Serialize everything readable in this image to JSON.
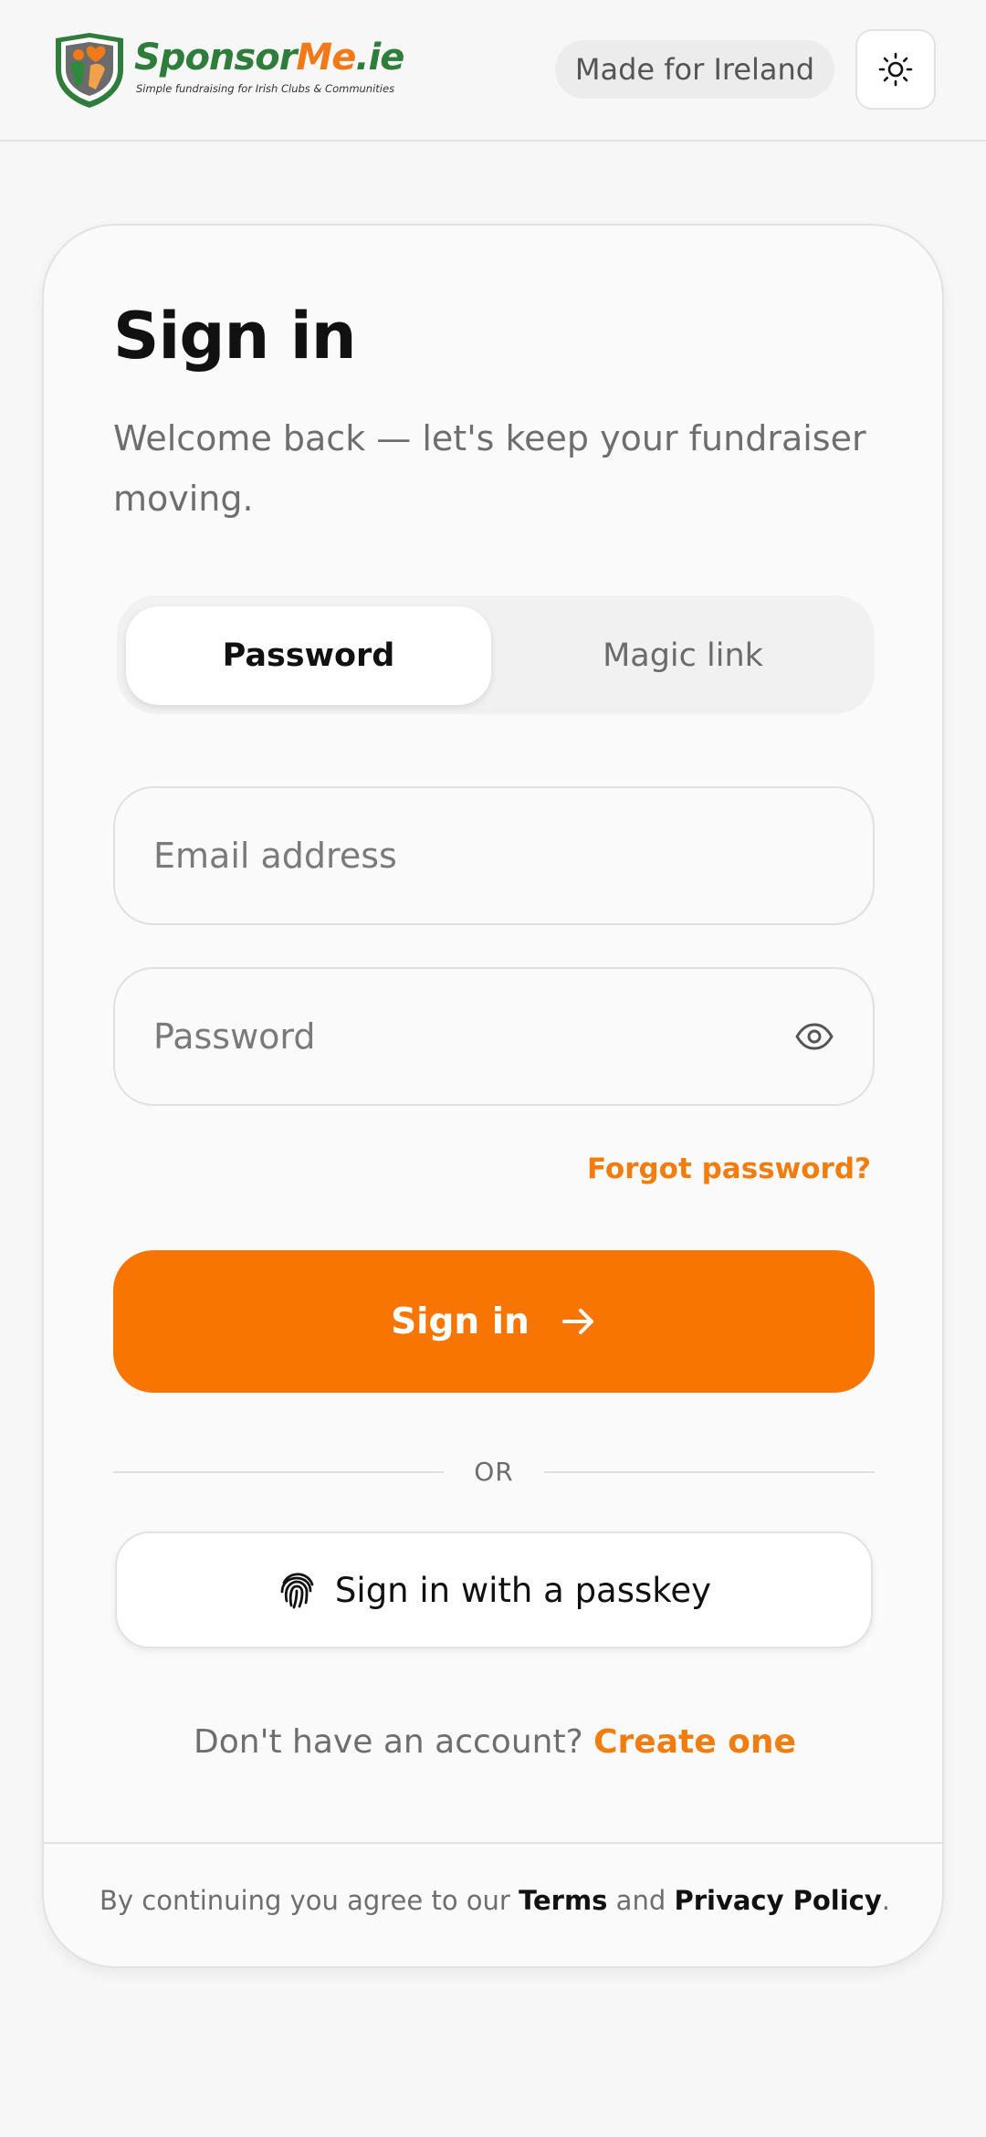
{
  "header": {
    "logo": {
      "name_part1": "Sponsor",
      "name_part2": "Me",
      "name_part3": ".ie",
      "tagline": "Simple fundraising for Irish Clubs & Communities"
    },
    "badge": "Made for Ireland",
    "theme_toggle_icon": "sun-icon"
  },
  "card": {
    "title": "Sign in",
    "subtitle": "Welcome back — let's keep your fundraiser moving.",
    "tabs": [
      {
        "label": "Password",
        "active": true
      },
      {
        "label": "Magic link",
        "active": false
      }
    ],
    "email": {
      "placeholder": "Email address",
      "value": ""
    },
    "password": {
      "placeholder": "Password",
      "value": "",
      "toggle_icon": "eye-icon"
    },
    "forgot_label": "Forgot password?",
    "submit_label": "Sign in",
    "submit_icon": "arrow-right-icon",
    "divider_label": "OR",
    "passkey_label": "Sign in with a passkey",
    "passkey_icon": "fingerprint-icon",
    "signup": {
      "prompt": "Don't have an account?",
      "link": "Create one"
    },
    "footer": {
      "prefix": "By continuing you agree to our",
      "terms": "Terms",
      "and": "and",
      "privacy": "Privacy Policy",
      "suffix": "."
    }
  },
  "colors": {
    "accent": "#f77500",
    "brand_green": "#2e7d3a",
    "background": "#f7f7f7"
  }
}
